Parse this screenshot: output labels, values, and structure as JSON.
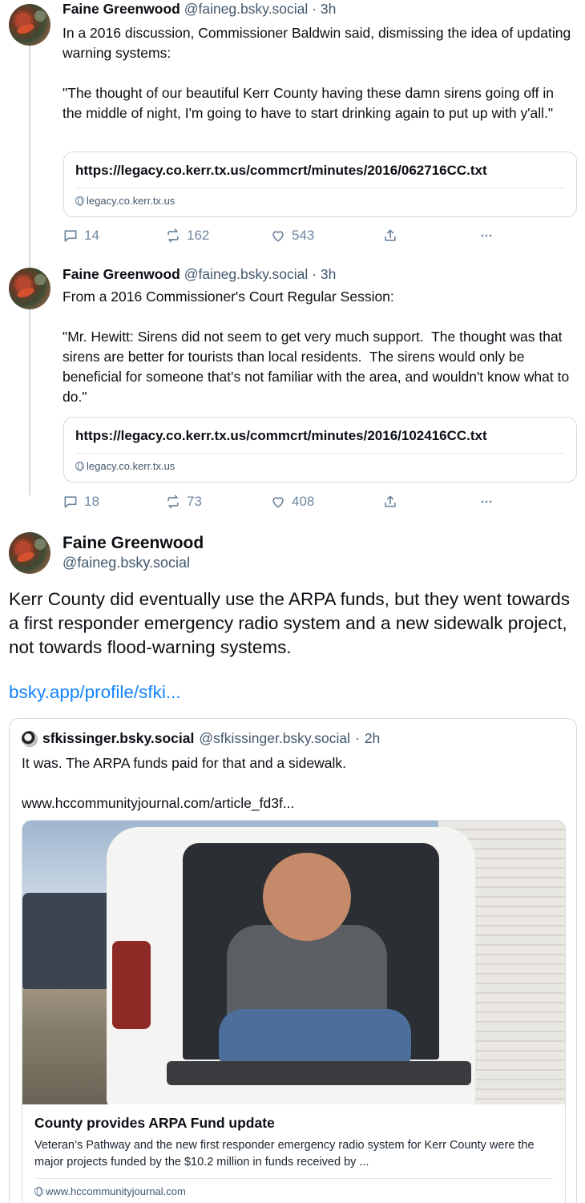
{
  "posts": [
    {
      "author_name": "Faine Greenwood",
      "author_handle": "@faineg.bsky.social",
      "separator": "·",
      "time": "3h",
      "text": "In a 2016 discussion, Commissioner Baldwin said, dismissing the idea of updating warning systems:\n\n\"The thought of our beautiful Kerr County having these damn sirens going off in the middle of night, I'm going to have to start drinking again to put up with y'all.\"",
      "link_card": {
        "title": "https://legacy.co.kerr.tx.us/commcrt/minutes/2016/062716CC.txt",
        "domain": "legacy.co.kerr.tx.us"
      },
      "replies": "14",
      "reposts": "162",
      "likes": "543"
    },
    {
      "author_name": "Faine Greenwood",
      "author_handle": "@faineg.bsky.social",
      "separator": "·",
      "time": "3h",
      "text": "From a 2016 Commissioner's Court Regular Session:\n\n\"Mr. Hewitt: Sirens did not seem to get very much support.  The thought was that sirens are better for tourists than local residents.  The sirens would only be beneficial for someone that's not familiar with the area, and wouldn't know what to do.\"",
      "link_card": {
        "title": "https://legacy.co.kerr.tx.us/commcrt/minutes/2016/102416CC.txt",
        "domain": "legacy.co.kerr.tx.us"
      },
      "replies": "18",
      "reposts": "73",
      "likes": "408"
    }
  ],
  "main_post": {
    "author_name": "Faine Greenwood",
    "author_handle": "@faineg.bsky.social",
    "text": "Kerr County did eventually use the ARPA funds, but they went towards a first responder emergency radio system and a new sidewalk project, not towards flood-warning systems.",
    "link": "bsky.app/profile/sfki...",
    "quote": {
      "author_name": "sfkissinger.bsky.social",
      "author_handle": "@sfkissinger.bsky.social",
      "separator": "·",
      "time": "2h",
      "text": "It was. The ARPA funds paid for that and a sidewalk.",
      "url": "www.hccommunityjournal.com/article_fd3f...",
      "embed": {
        "title": "County provides ARPA Fund update",
        "description": "Veteran’s Pathway and the new first responder emergency radio system for Kerr County were the major projects funded by the $10.2 million in funds received by ...",
        "domain": "www.hccommunityjournal.com"
      }
    }
  },
  "icons": [
    "reply-icon",
    "repost-icon",
    "like-icon",
    "share-icon",
    "more-icon",
    "globe-icon"
  ],
  "colors": {
    "link": "#1083fe",
    "muted": "#42576c",
    "icon": "#6f869f",
    "border": "#d4dbe2"
  }
}
